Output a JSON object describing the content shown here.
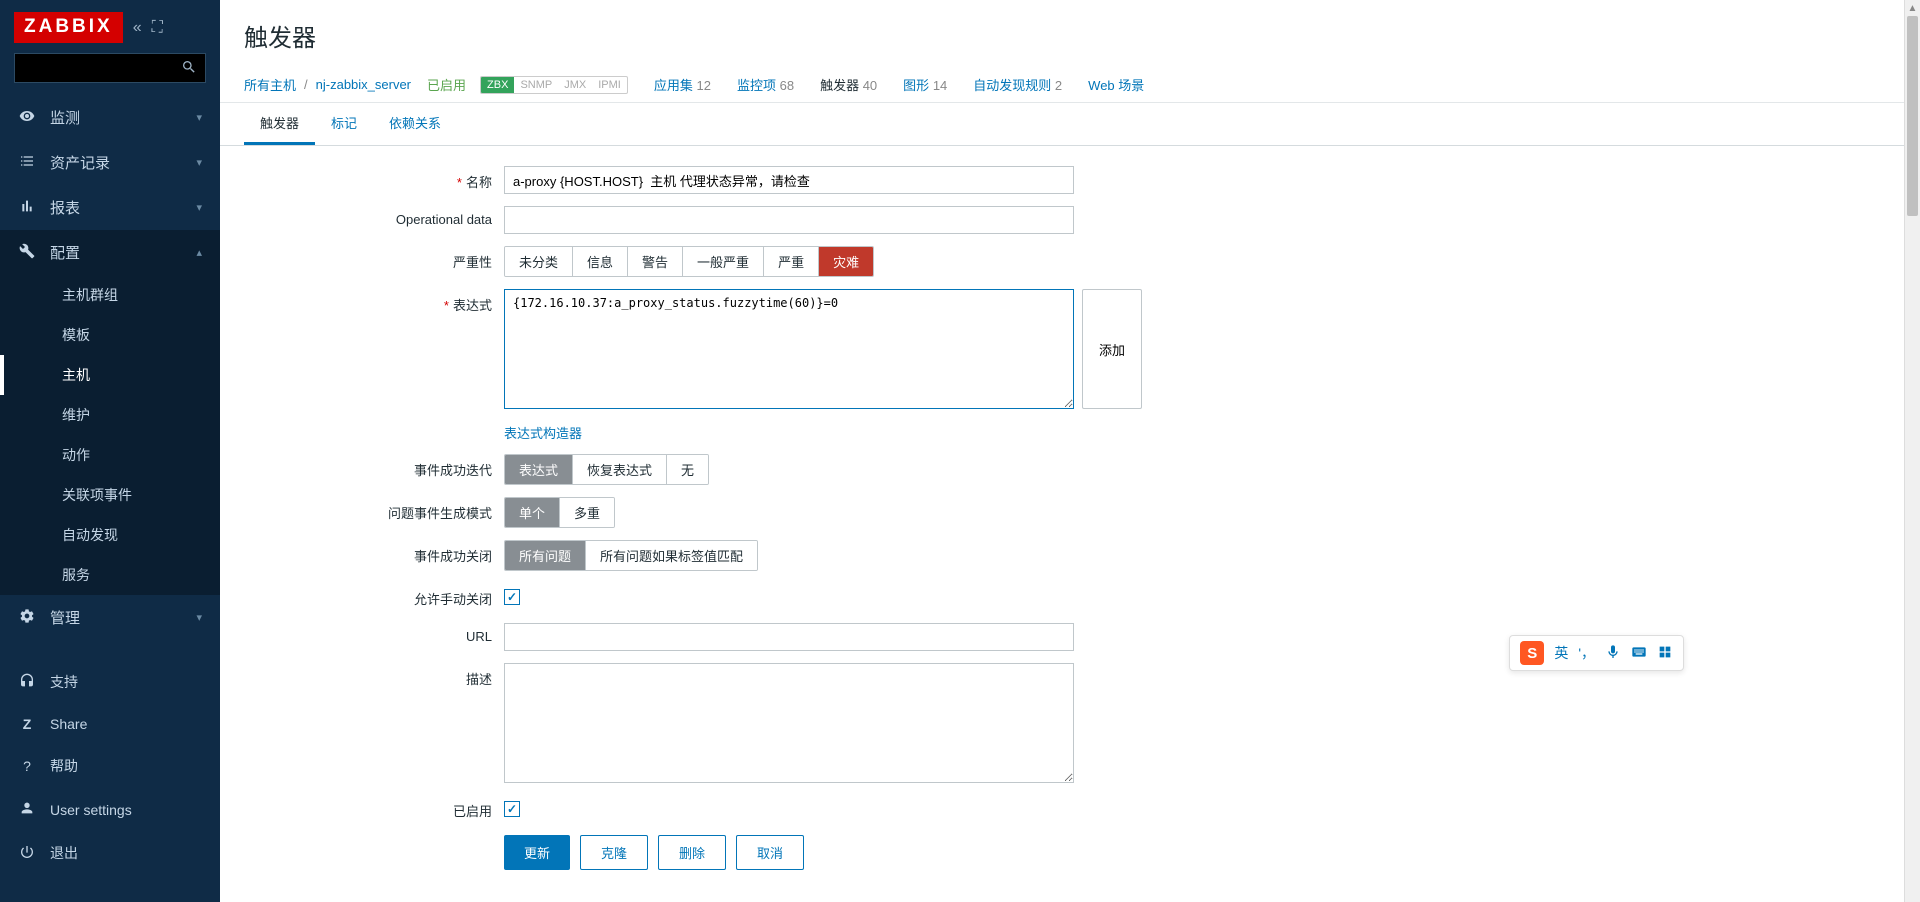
{
  "logo": "ZABBIX",
  "sidebar": {
    "sections": [
      {
        "icon": "eye",
        "label": "监测"
      },
      {
        "icon": "list",
        "label": "资产记录"
      },
      {
        "icon": "chart",
        "label": "报表"
      },
      {
        "icon": "wrench",
        "label": "配置"
      },
      {
        "icon": "gear",
        "label": "管理"
      }
    ],
    "config_items": [
      {
        "label": "主机群组"
      },
      {
        "label": "模板"
      },
      {
        "label": "主机"
      },
      {
        "label": "维护"
      },
      {
        "label": "动作"
      },
      {
        "label": "关联项事件"
      },
      {
        "label": "自动发现"
      },
      {
        "label": "服务"
      }
    ],
    "bottom": [
      {
        "icon": "headset",
        "label": "支持"
      },
      {
        "icon": "z",
        "label": "Share"
      },
      {
        "icon": "question",
        "label": "帮助"
      },
      {
        "icon": "user",
        "label": "User settings"
      },
      {
        "icon": "power",
        "label": "退出"
      }
    ]
  },
  "page": {
    "title": "触发器",
    "breadcrumb": {
      "all_hosts": "所有主机",
      "host": "nj-zabbix_server",
      "enabled": "已启用"
    },
    "agents": {
      "zbx": "ZBX",
      "snmp": "SNMP",
      "jmx": "JMX",
      "ipmi": "IPMI"
    },
    "filters": [
      {
        "label": "应用集",
        "count": "12"
      },
      {
        "label": "监控项",
        "count": "68"
      },
      {
        "label": "触发器",
        "count": "40",
        "active": true
      },
      {
        "label": "图形",
        "count": "14"
      },
      {
        "label": "自动发现规则",
        "count": "2"
      },
      {
        "label": "Web 场景",
        "count": ""
      }
    ],
    "tabs": [
      {
        "label": "触发器",
        "active": true
      },
      {
        "label": "标记"
      },
      {
        "label": "依赖关系"
      }
    ]
  },
  "form": {
    "name_label": "名称",
    "name_value": "a-proxy {HOST.HOST}  主机 代理状态异常，请检查",
    "opdata_label": "Operational data",
    "opdata_value": "",
    "severity_label": "严重性",
    "severity_options": [
      "未分类",
      "信息",
      "警告",
      "一般严重",
      "严重",
      "灾难"
    ],
    "expression_label": "表达式",
    "expression_value": "{172.16.10.37:a_proxy_status.fuzzytime(60)}=0",
    "add_button": "添加",
    "expr_constructor": "表达式构造器",
    "ok_event_label": "事件成功迭代",
    "ok_event_options": [
      "表达式",
      "恢复表达式",
      "无"
    ],
    "problem_mode_label": "问题事件生成模式",
    "problem_mode_options": [
      "单个",
      "多重"
    ],
    "ok_close_label": "事件成功关闭",
    "ok_close_options": [
      "所有问题",
      "所有问题如果标签值匹配"
    ],
    "manual_close_label": "允许手动关闭",
    "url_label": "URL",
    "url_value": "",
    "desc_label": "描述",
    "desc_value": "",
    "enabled_label": "已启用",
    "buttons": {
      "update": "更新",
      "clone": "克隆",
      "delete": "删除",
      "cancel": "取消"
    }
  },
  "ime": {
    "lang": "英"
  }
}
